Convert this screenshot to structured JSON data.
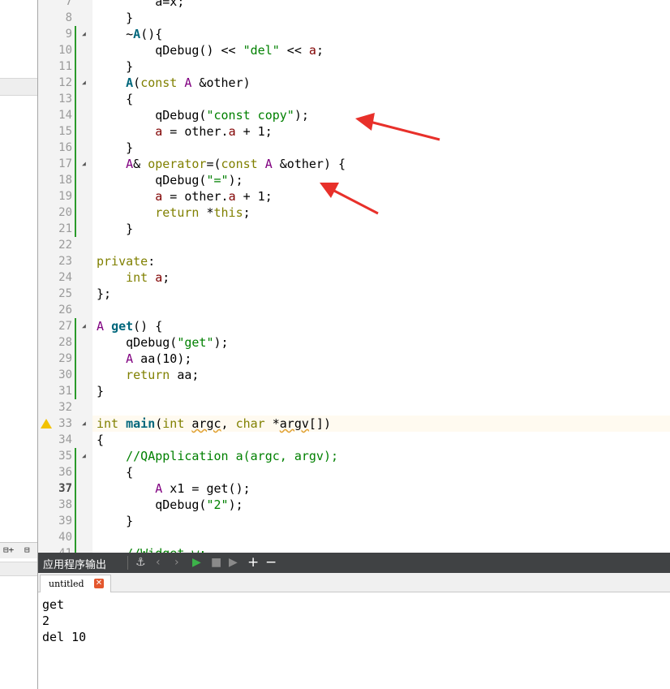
{
  "editor": {
    "lines": [
      {
        "n": "7",
        "t": [
          {
            "c": "",
            "s": "        a=x;"
          }
        ]
      },
      {
        "n": "8",
        "t": [
          {
            "c": "",
            "s": "    }"
          }
        ]
      },
      {
        "n": "9",
        "t": [
          {
            "c": "",
            "s": "    ~"
          },
          {
            "c": "fn",
            "s": "A"
          },
          {
            "c": "",
            "s": "(){"
          }
        ]
      },
      {
        "n": "10",
        "t": [
          {
            "c": "",
            "s": "        qDebug() << "
          },
          {
            "c": "st",
            "s": "\"del\""
          },
          {
            "c": "",
            "s": " << "
          },
          {
            "c": "mem",
            "s": "a"
          },
          {
            "c": "",
            "s": ";"
          }
        ]
      },
      {
        "n": "11",
        "t": [
          {
            "c": "",
            "s": "    }"
          }
        ]
      },
      {
        "n": "12",
        "t": [
          {
            "c": "",
            "s": "    "
          },
          {
            "c": "fn",
            "s": "A"
          },
          {
            "c": "",
            "s": "("
          },
          {
            "c": "kw",
            "s": "const"
          },
          {
            "c": "",
            "s": " "
          },
          {
            "c": "ty",
            "s": "A"
          },
          {
            "c": "",
            "s": " &other)"
          }
        ]
      },
      {
        "n": "13",
        "t": [
          {
            "c": "",
            "s": "    {"
          }
        ]
      },
      {
        "n": "14",
        "t": [
          {
            "c": "",
            "s": "        qDebug("
          },
          {
            "c": "st",
            "s": "\"const copy\""
          },
          {
            "c": "",
            "s": ");"
          }
        ]
      },
      {
        "n": "15",
        "t": [
          {
            "c": "",
            "s": "        "
          },
          {
            "c": "mem",
            "s": "a"
          },
          {
            "c": "",
            "s": " = other."
          },
          {
            "c": "mem",
            "s": "a"
          },
          {
            "c": "",
            "s": " + 1;"
          }
        ]
      },
      {
        "n": "16",
        "t": [
          {
            "c": "",
            "s": "    }"
          }
        ]
      },
      {
        "n": "17",
        "t": [
          {
            "c": "",
            "s": "    "
          },
          {
            "c": "ty",
            "s": "A"
          },
          {
            "c": "",
            "s": "& "
          },
          {
            "c": "kw",
            "s": "operator"
          },
          {
            "c": "",
            "s": "=("
          },
          {
            "c": "kw",
            "s": "const"
          },
          {
            "c": "",
            "s": " "
          },
          {
            "c": "ty",
            "s": "A"
          },
          {
            "c": "",
            "s": " &other) {"
          }
        ]
      },
      {
        "n": "18",
        "t": [
          {
            "c": "",
            "s": "        qDebug("
          },
          {
            "c": "st",
            "s": "\"=\""
          },
          {
            "c": "",
            "s": ");"
          }
        ]
      },
      {
        "n": "19",
        "t": [
          {
            "c": "",
            "s": "        "
          },
          {
            "c": "mem",
            "s": "a"
          },
          {
            "c": "",
            "s": " = other."
          },
          {
            "c": "mem",
            "s": "a"
          },
          {
            "c": "",
            "s": " + 1;"
          }
        ]
      },
      {
        "n": "20",
        "t": [
          {
            "c": "",
            "s": "        "
          },
          {
            "c": "kw",
            "s": "return"
          },
          {
            "c": "",
            "s": " *"
          },
          {
            "c": "kw",
            "s": "this"
          },
          {
            "c": "",
            "s": ";"
          }
        ]
      },
      {
        "n": "21",
        "t": [
          {
            "c": "",
            "s": "    }"
          }
        ]
      },
      {
        "n": "22",
        "t": [
          {
            "c": "",
            "s": ""
          }
        ]
      },
      {
        "n": "23",
        "t": [
          {
            "c": "kw",
            "s": "private"
          },
          {
            "c": "",
            "s": ":"
          }
        ]
      },
      {
        "n": "24",
        "t": [
          {
            "c": "",
            "s": "    "
          },
          {
            "c": "kw",
            "s": "int"
          },
          {
            "c": "",
            "s": " "
          },
          {
            "c": "mem",
            "s": "a"
          },
          {
            "c": "",
            "s": ";"
          }
        ]
      },
      {
        "n": "25",
        "t": [
          {
            "c": "",
            "s": "};"
          }
        ]
      },
      {
        "n": "26",
        "t": [
          {
            "c": "",
            "s": ""
          }
        ]
      },
      {
        "n": "27",
        "t": [
          {
            "c": "ty",
            "s": "A"
          },
          {
            "c": "",
            "s": " "
          },
          {
            "c": "fn",
            "s": "get"
          },
          {
            "c": "",
            "s": "() {"
          }
        ]
      },
      {
        "n": "28",
        "t": [
          {
            "c": "",
            "s": "    qDebug("
          },
          {
            "c": "st",
            "s": "\"get\""
          },
          {
            "c": "",
            "s": ");"
          }
        ]
      },
      {
        "n": "29",
        "t": [
          {
            "c": "",
            "s": "    "
          },
          {
            "c": "ty",
            "s": "A"
          },
          {
            "c": "",
            "s": " aa(10);"
          }
        ]
      },
      {
        "n": "30",
        "t": [
          {
            "c": "",
            "s": "    "
          },
          {
            "c": "kw",
            "s": "return"
          },
          {
            "c": "",
            "s": " aa;"
          }
        ]
      },
      {
        "n": "31",
        "t": [
          {
            "c": "",
            "s": "}"
          }
        ]
      },
      {
        "n": "32",
        "t": [
          {
            "c": "",
            "s": ""
          }
        ]
      },
      {
        "n": "33",
        "t": [
          {
            "c": "kw",
            "s": "int"
          },
          {
            "c": "",
            "s": " "
          },
          {
            "c": "fn",
            "s": "main"
          },
          {
            "c": "",
            "s": "("
          },
          {
            "c": "kw",
            "s": "int"
          },
          {
            "c": "",
            "s": " "
          },
          {
            "c": "un",
            "s": "argc"
          },
          {
            "c": "",
            "s": ", "
          },
          {
            "c": "kw",
            "s": "char"
          },
          {
            "c": "",
            "s": " *"
          },
          {
            "c": "un",
            "s": "argv"
          },
          {
            "c": "",
            "s": "[])"
          }
        ]
      },
      {
        "n": "34",
        "t": [
          {
            "c": "",
            "s": "{"
          }
        ]
      },
      {
        "n": "35",
        "t": [
          {
            "c": "",
            "s": "    "
          },
          {
            "c": "cm",
            "s": "//QApplication a(argc, argv);"
          }
        ]
      },
      {
        "n": "36",
        "t": [
          {
            "c": "",
            "s": "    {"
          }
        ]
      },
      {
        "n": "37",
        "t": [
          {
            "c": "",
            "s": "        "
          },
          {
            "c": "ty",
            "s": "A"
          },
          {
            "c": "",
            "s": " x1 = get();"
          }
        ]
      },
      {
        "n": "38",
        "t": [
          {
            "c": "",
            "s": "        qDebug("
          },
          {
            "c": "st",
            "s": "\"2\""
          },
          {
            "c": "",
            "s": ");"
          }
        ]
      },
      {
        "n": "39",
        "t": [
          {
            "c": "",
            "s": "    }"
          }
        ]
      },
      {
        "n": "40",
        "t": [
          {
            "c": "",
            "s": ""
          }
        ]
      },
      {
        "n": "41",
        "t": [
          {
            "c": "",
            "s": "    "
          },
          {
            "c": "cm",
            "s": "//Widget w;"
          }
        ]
      }
    ],
    "current_line": "37",
    "warning_line": "33",
    "fold_lines": [
      "9",
      "12",
      "17",
      "27",
      "33",
      "35"
    ]
  },
  "output": {
    "title": "应用程序输出",
    "tab_label": "untitled",
    "lines": [
      "get",
      "2",
      "del 10"
    ]
  },
  "left_strip": {
    "button1": "⊟+",
    "button2": "⊟"
  },
  "colors": {
    "annotation_arrow": "#e8302a",
    "output_header_bg": "#404244",
    "run_green": "#3cb34a"
  }
}
